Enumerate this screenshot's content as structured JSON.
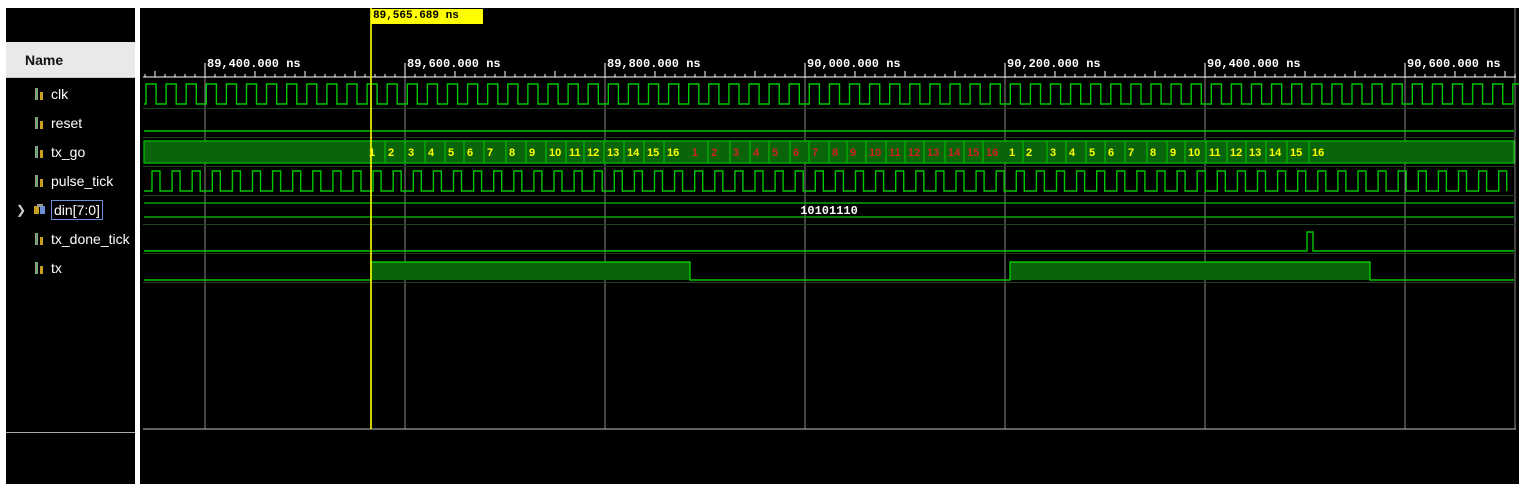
{
  "name_column_header": "Name",
  "signals": [
    {
      "name": "clk",
      "icon": "logic-signal-icon"
    },
    {
      "name": "reset",
      "icon": "logic-signal-icon"
    },
    {
      "name": "tx_go",
      "icon": "logic-signal-icon"
    },
    {
      "name": "pulse_tick",
      "icon": "logic-signal-icon"
    },
    {
      "name": "din[7:0]",
      "icon": "bus-signal-icon"
    },
    {
      "name": "tx_done_tick",
      "icon": "logic-signal-icon"
    },
    {
      "name": "tx",
      "icon": "logic-signal-icon"
    }
  ],
  "cursor": {
    "time": "89,565.689 ns"
  },
  "time_ruler": {
    "labels": [
      "89,400.000 ns",
      "89,600.000 ns",
      "89,800.000 ns",
      "90,000.000 ns",
      "90,200.000 ns",
      "90,400.000 ns",
      "90,600.000 ns"
    ]
  },
  "din_value": "10101110",
  "tx_go_counts": {
    "first_yellow": [
      "1",
      "2",
      "3",
      "4",
      "5",
      "6",
      "7",
      "8",
      "9",
      "10",
      "11",
      "12",
      "13",
      "14",
      "15",
      "16"
    ],
    "red": [
      "1",
      "2",
      "3",
      "4",
      "5",
      "6",
      "7",
      "8",
      "9",
      "10",
      "11",
      "12",
      "13",
      "14",
      "15",
      "16"
    ],
    "second_yellow": [
      "1",
      "2",
      "3",
      "4",
      "5",
      "6",
      "7",
      "8",
      "9",
      "10",
      "11",
      "12",
      "13",
      "14",
      "15",
      "16"
    ]
  },
  "colors": {
    "wave": "#00c800",
    "bus_fill": "#0a640a",
    "cursor": "#ffff00",
    "count_yellow": "#ffff00",
    "count_red": "#d22020",
    "grid": "#c0c0c0",
    "background": "#000000"
  }
}
